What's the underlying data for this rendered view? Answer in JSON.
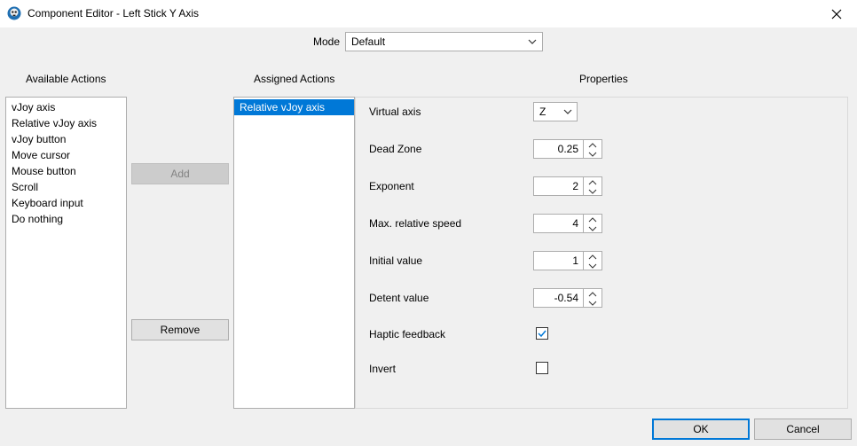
{
  "window": {
    "title": "Component Editor - Left Stick Y Axis",
    "icon": "gamepad-skull-icon",
    "close_icon": "close-icon"
  },
  "mode": {
    "label": "Mode",
    "value": "Default"
  },
  "available_actions": {
    "title": "Available Actions",
    "items": [
      "vJoy axis",
      "Relative vJoy axis",
      "vJoy button",
      "Move cursor",
      "Mouse button",
      "Scroll",
      "Keyboard input",
      "Do nothing"
    ]
  },
  "buttons": {
    "add": "Add",
    "remove": "Remove",
    "ok": "OK",
    "cancel": "Cancel"
  },
  "assigned_actions": {
    "title": "Assigned Actions",
    "items": [
      "Relative vJoy axis"
    ],
    "selected_index": 0
  },
  "properties": {
    "title": "Properties",
    "virtual_axis": {
      "label": "Virtual axis",
      "value": "Z"
    },
    "dead_zone": {
      "label": "Dead Zone",
      "value": "0.25"
    },
    "exponent": {
      "label": "Exponent",
      "value": "2"
    },
    "max_relative_speed": {
      "label": "Max. relative speed",
      "value": "4"
    },
    "initial_value": {
      "label": "Initial value",
      "value": "1"
    },
    "detent_value": {
      "label": "Detent value",
      "value": "-0.54"
    },
    "haptic_feedback": {
      "label": "Haptic feedback",
      "checked": true
    },
    "invert": {
      "label": "Invert",
      "checked": false
    }
  },
  "colors": {
    "selection": "#0078d7",
    "panel_bg": "#f0f0f0"
  }
}
